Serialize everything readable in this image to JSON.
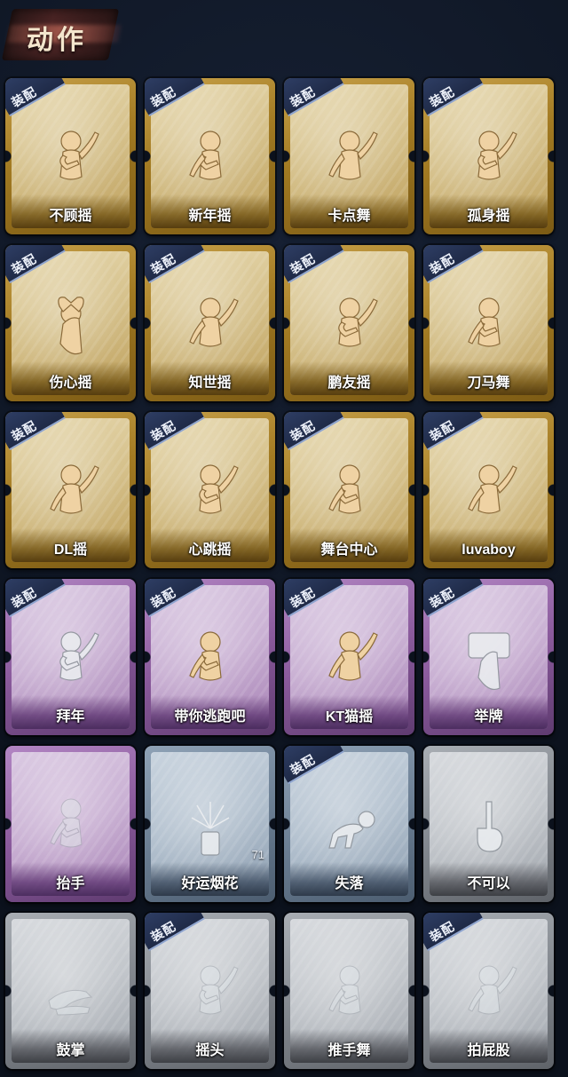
{
  "header": {
    "title": "动作"
  },
  "labels": {
    "equip": "装配"
  },
  "cards": [
    {
      "name": "不顾摇",
      "tier": "gold",
      "equipped": true,
      "figure": "gold",
      "icon": "dance-figure-icon"
    },
    {
      "name": "新年摇",
      "tier": "gold",
      "equipped": true,
      "figure": "gold",
      "icon": "dance-figure-icon"
    },
    {
      "name": "卡点舞",
      "tier": "gold",
      "equipped": true,
      "figure": "gold",
      "icon": "dance-figure-icon"
    },
    {
      "name": "孤身摇",
      "tier": "gold",
      "equipped": true,
      "figure": "gold",
      "icon": "dance-figure-icon"
    },
    {
      "name": "伤心摇",
      "tier": "gold",
      "equipped": true,
      "figure": "gold",
      "icon": "heart-hands-figure-icon"
    },
    {
      "name": "知世摇",
      "tier": "gold",
      "equipped": true,
      "figure": "gold",
      "icon": "dance-figure-icon"
    },
    {
      "name": "鹏友摇",
      "tier": "gold",
      "equipped": true,
      "figure": "gold",
      "icon": "dance-figure-icon"
    },
    {
      "name": "刀马舞",
      "tier": "gold",
      "equipped": true,
      "figure": "gold",
      "icon": "dance-figure-icon"
    },
    {
      "name": "DL摇",
      "tier": "gold",
      "equipped": true,
      "figure": "gold",
      "icon": "dance-figure-icon"
    },
    {
      "name": "心跳摇",
      "tier": "gold",
      "equipped": true,
      "figure": "gold",
      "icon": "dance-figure-icon"
    },
    {
      "name": "舞台中心",
      "tier": "gold",
      "equipped": true,
      "figure": "gold",
      "icon": "dance-figure-icon"
    },
    {
      "name": "luvaboy",
      "tier": "gold",
      "equipped": true,
      "figure": "gold",
      "icon": "dance-figure-icon"
    },
    {
      "name": "拜年",
      "tier": "purple",
      "equipped": true,
      "figure": "silver",
      "icon": "bow-figure-icon"
    },
    {
      "name": "带你逃跑吧",
      "tier": "purple",
      "equipped": true,
      "figure": "gold",
      "icon": "dance-figure-icon"
    },
    {
      "name": "KT猫摇",
      "tier": "purple",
      "equipped": true,
      "figure": "gold",
      "icon": "dance-figure-icon"
    },
    {
      "name": "举牌",
      "tier": "purple",
      "equipped": true,
      "figure": "silver",
      "icon": "sign-figure-icon"
    },
    {
      "name": "抬手",
      "tier": "purple",
      "equipped": false,
      "figure": "faded",
      "icon": "raise-hand-figure-icon"
    },
    {
      "name": "好运烟花",
      "tier": "blue",
      "equipped": false,
      "figure": "silver",
      "icon": "firework-icon",
      "count": "71"
    },
    {
      "name": "失落",
      "tier": "blue",
      "equipped": true,
      "figure": "silver",
      "icon": "crawl-figure-icon"
    },
    {
      "name": "不可以",
      "tier": "gray",
      "equipped": false,
      "figure": "silver",
      "icon": "finger-wag-icon"
    },
    {
      "name": "鼓掌",
      "tier": "gray",
      "equipped": false,
      "figure": "faded",
      "icon": "clap-hands-icon"
    },
    {
      "name": "摇头",
      "tier": "gray",
      "equipped": true,
      "figure": "faded",
      "icon": "dance-figure-icon"
    },
    {
      "name": "推手舞",
      "tier": "gray",
      "equipped": false,
      "figure": "faded",
      "icon": "dance-figure-icon"
    },
    {
      "name": "拍屁股",
      "tier": "gray",
      "equipped": true,
      "figure": "faded",
      "icon": "dance-figure-icon"
    }
  ]
}
